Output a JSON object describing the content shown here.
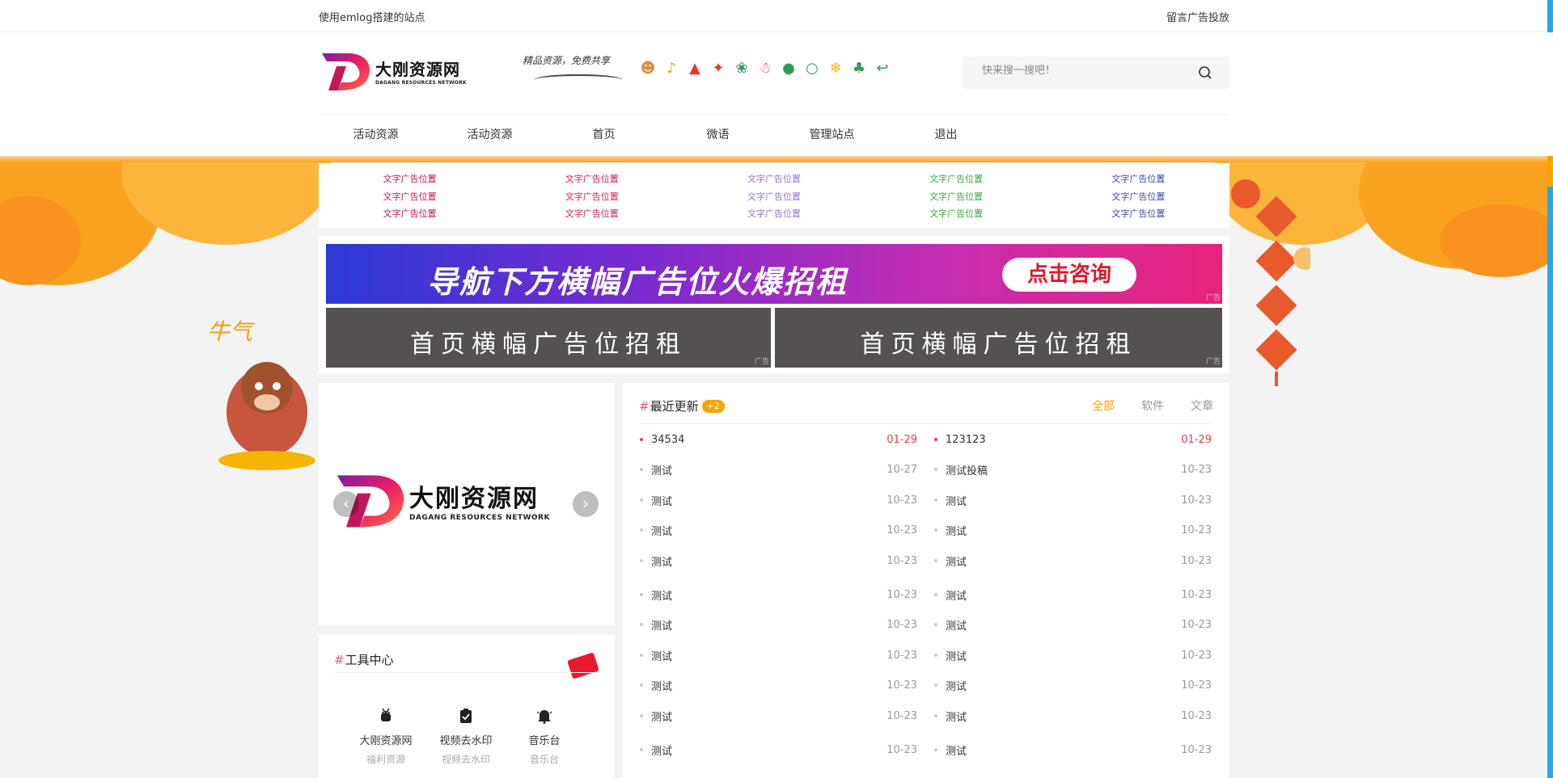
{
  "topbar": {
    "site_text": "使用emlog搭建的站点",
    "ad_link": "留言广告投放"
  },
  "logo": {
    "cn": "大刚资源网",
    "en": "DAGANG RESOURCES NETWORK"
  },
  "slogan": "精品资源，免费共享",
  "search": {
    "placeholder": "快来搜一搜吧！"
  },
  "nav": [
    "活动资源",
    "活动资源",
    "首页",
    "微语",
    "管理站点",
    "退出"
  ],
  "text_ads": {
    "label": "文字广告位置",
    "colors": [
      "#c2185b",
      "#d81b60",
      "#9575cd",
      "#43a047",
      "#3949ab"
    ]
  },
  "banners": {
    "top_text": "导航下方横幅广告位火爆招租",
    "top_button": "点击咨询",
    "gray_left": "首页横幅广告位招租",
    "gray_right": "首页横幅广告位招租",
    "ad_tag": "广告"
  },
  "carousel": {
    "cn": "大刚资源网",
    "en": "DAGANG RESOURCES NETWORK",
    "prev": "‹",
    "next": "›"
  },
  "tools": {
    "title": "工具中心",
    "items": [
      {
        "icon": "android-icon",
        "name": "大刚资源网",
        "sub": "福利资源"
      },
      {
        "icon": "clipboard-check-icon",
        "name": "视频去水印",
        "sub": "视频去水印"
      },
      {
        "icon": "bell-icon",
        "name": "音乐台",
        "sub": "音乐台"
      }
    ]
  },
  "updates": {
    "title": "最近更新",
    "badge": "+2",
    "tabs": [
      "全部",
      "软件",
      "文章"
    ],
    "left": [
      {
        "title": "34534",
        "date": "01-29",
        "hot": true
      },
      {
        "title": "测试",
        "date": "10-27"
      },
      {
        "title": "测试",
        "date": "10-23"
      },
      {
        "title": "测试",
        "date": "10-23"
      },
      {
        "title": "测试",
        "date": "10-23"
      },
      {
        "title": "测试",
        "date": "10-23"
      },
      {
        "title": "测试",
        "date": "10-23"
      },
      {
        "title": "测试",
        "date": "10-23"
      },
      {
        "title": "测试",
        "date": "10-23"
      },
      {
        "title": "测试",
        "date": "10-23"
      },
      {
        "title": "测试",
        "date": "10-23"
      }
    ],
    "right": [
      {
        "title": "123123",
        "date": "01-29",
        "hot": true
      },
      {
        "title": "测试投稿",
        "date": "10-23"
      },
      {
        "title": "测试",
        "date": "10-23"
      },
      {
        "title": "测试",
        "date": "10-23"
      },
      {
        "title": "测试",
        "date": "10-23"
      },
      {
        "title": "测试",
        "date": "10-23"
      },
      {
        "title": "测试",
        "date": "10-23"
      },
      {
        "title": "测试",
        "date": "10-23"
      },
      {
        "title": "测试",
        "date": "10-23"
      },
      {
        "title": "测试",
        "date": "10-23"
      },
      {
        "title": "测试",
        "date": "10-23"
      }
    ]
  },
  "colors": {
    "accent": "#f6a400",
    "hot": "#e83b4a",
    "hash": "#f0577a"
  }
}
